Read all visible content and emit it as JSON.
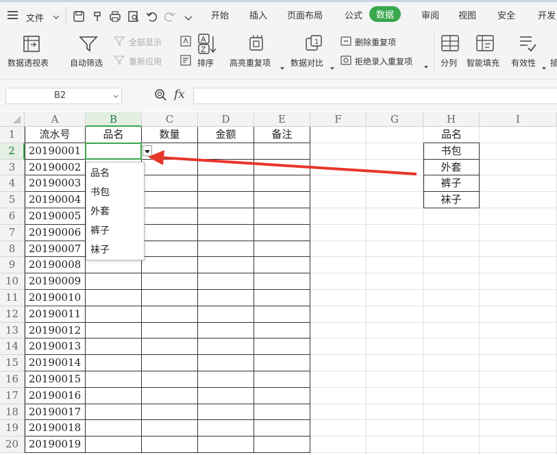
{
  "menubar": {
    "file_label": "文件",
    "tabs": [
      {
        "label": "开始",
        "active": false
      },
      {
        "label": "插入",
        "active": false
      },
      {
        "label": "页面布局",
        "active": false
      },
      {
        "label": "公式",
        "active": false
      },
      {
        "label": "数据",
        "active": true
      },
      {
        "label": "审阅",
        "active": false
      },
      {
        "label": "视图",
        "active": false
      },
      {
        "label": "安全",
        "active": false
      },
      {
        "label": "开发",
        "active": false
      }
    ],
    "accent_color": "#39a74c"
  },
  "ribbon": {
    "pivot_table": "数据透视表",
    "auto_filter": "自动筛选",
    "show_all": "全部显示",
    "reapply": "重新应用",
    "sort": "排序",
    "highlight_duplicates": "高亮重复项",
    "data_compare": "数据对比",
    "remove_duplicates": "删除重复项",
    "reject_duplicates": "拒绝录入重复项",
    "text_to_columns": "分列",
    "flash_fill": "智能填充",
    "validation": "有效性",
    "more": "插"
  },
  "formula_bar": {
    "name_box": "B2",
    "fx_label": "fx",
    "content": ""
  },
  "grid": {
    "columns": [
      "A",
      "B",
      "C",
      "D",
      "E",
      "F",
      "G",
      "H",
      "I"
    ],
    "selected_column": "B",
    "rows": [
      "1",
      "2",
      "3",
      "4",
      "5",
      "6",
      "7",
      "8",
      "9",
      "10",
      "11",
      "12",
      "13",
      "14",
      "15",
      "16",
      "17",
      "18",
      "19",
      "20"
    ],
    "selected_row": "2",
    "headers": [
      "流水号",
      "品名",
      "数量",
      "金额",
      "备注"
    ],
    "serials": [
      "20190001",
      "20190002",
      "20190003",
      "20190004",
      "20190005",
      "20190006",
      "20190007",
      "20190008",
      "20190009",
      "20190010",
      "20190011",
      "20190012",
      "20190013",
      "20190014",
      "20190015",
      "20190016",
      "20190017",
      "20190018",
      "20190019"
    ],
    "lookup": [
      "品名",
      "书包",
      "外套",
      "裤子",
      "袜子"
    ]
  },
  "dropdown": {
    "items": [
      "品名",
      "书包",
      "外套",
      "裤子",
      "袜子"
    ]
  },
  "annotation": {
    "arrow_color": "#e8352b"
  }
}
